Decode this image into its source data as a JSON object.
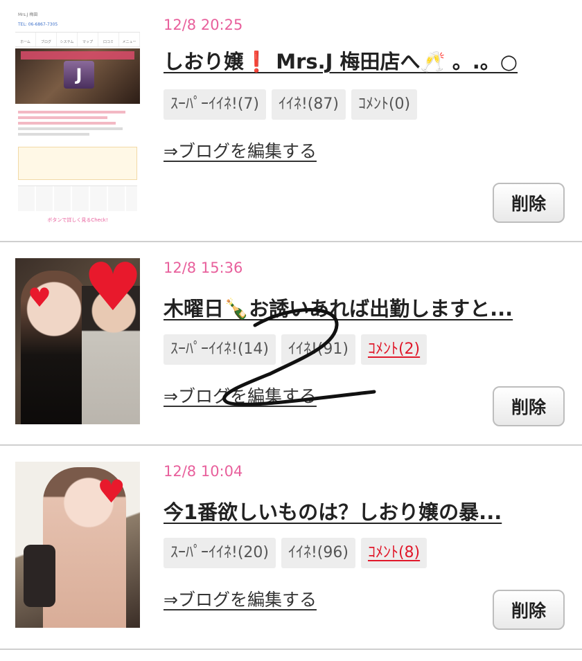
{
  "posts": [
    {
      "date": "12/8 20:25",
      "title": "しおり嬢❗ Mrs.J 梅田店へ🥂 。.。○",
      "super_like": "ｽｰﾊﾟｰｲｲﾈ!(7)",
      "like": "ｲｲﾈ!(87)",
      "comment": "ｺﾒﾝﾄ(0)",
      "edit": "⇒ブログを編集する",
      "delete": "削除",
      "thumb": {
        "site_name": "Mrs.J 梅田",
        "tel": "TEL: 06-6867-7305",
        "nav": [
          "ホーム",
          "ブログ",
          "システム",
          "マップ",
          "口コミ",
          "メニュー"
        ],
        "banner_mark": "J",
        "footer": "ボタンで詳しく見るCheck!"
      }
    },
    {
      "date": "12/8 15:36",
      "title": "木曜日🍾お誘いあれば出勤しますと...",
      "super_like": "ｽｰﾊﾟｰｲｲﾈ!(14)",
      "like": "ｲｲﾈ!(91)",
      "comment": "ｺﾒﾝﾄ(2)",
      "edit": "⇒ブログを編集する",
      "delete": "削除"
    },
    {
      "date": "12/8 10:04",
      "title": "今1番欲しいものは？しおり嬢の暴...",
      "super_like": "ｽｰﾊﾟｰｲｲﾈ!(20)",
      "like": "ｲｲﾈ!(96)",
      "comment": "ｺﾒﾝﾄ(8)",
      "edit": "⇒ブログを編集する",
      "delete": "削除"
    }
  ],
  "colors": {
    "date": "#e8609c",
    "comment_active": "#e0182a",
    "tag_bg": "#ededed"
  },
  "annotation": {
    "kind": "handwritten-scribble",
    "shape": "digit-2"
  }
}
